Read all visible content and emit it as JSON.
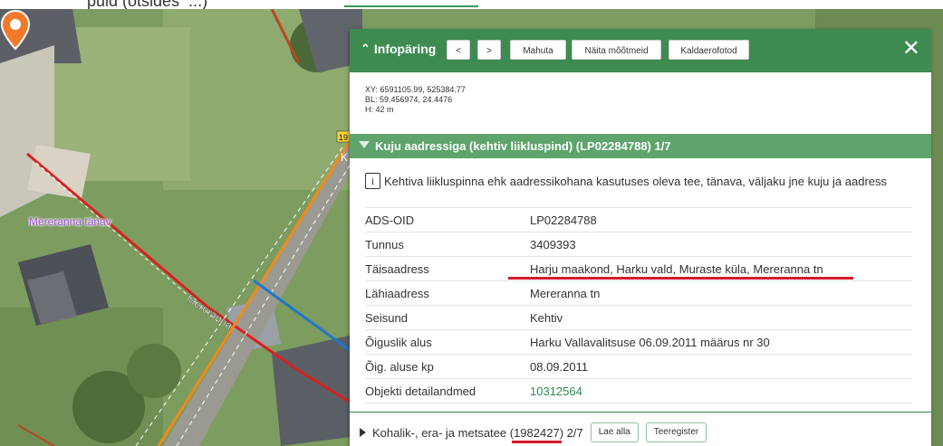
{
  "top_strip": {
    "partial_text": "puid (otsides  ...)"
  },
  "map": {
    "street_label": "Mereranna tänav",
    "road_label_rotated": "Mereranna",
    "road_number": "19",
    "road_letter": "K"
  },
  "panel": {
    "title": "Infopäring",
    "buttons": {
      "prev": "<",
      "next": ">",
      "fit": "Mahuta",
      "measurements": "Näita mõõtmeid",
      "oblique": "Kaldaerofotod"
    },
    "close": "✕",
    "coords": {
      "xy": "XY: 6591105.99, 525384.77",
      "bl": "BL: 59.456974, 24.4476",
      "h": "H: 42 m"
    },
    "section1": {
      "title": "Kuju aadressiga (kehtiv liikluspind) (LP02284788) 1/7",
      "description": "Kehtiva liikluspinna ehk aadressikohana kasutuses oleva tee, tänava, väljaku jne kuju ja aadress",
      "rows": [
        {
          "key": "ADS-OID",
          "value": "LP02284788"
        },
        {
          "key": "Tunnus",
          "value": "3409393"
        },
        {
          "key": "Täisaadress",
          "value": "Harju maakond, Harku vald, Muraste küla, Mereranna tn"
        },
        {
          "key": "Lähiaadress",
          "value": "Mereranna tn"
        },
        {
          "key": "Seisund",
          "value": "Kehtiv"
        },
        {
          "key": "Õiguslik alus",
          "value": "Harku Vallavalitsuse 06.09.2011 määrus nr 30"
        },
        {
          "key": "Õig. aluse kp",
          "value": "08.09.2011"
        },
        {
          "key": "Objekti detailandmed",
          "value": "10312564"
        }
      ]
    },
    "section2": {
      "title_prefix": "Kohalik-, era- ja metsatee (",
      "title_id": "1982427",
      "title_suffix": ") 2/7",
      "download": "Lae alla",
      "registry": "Teeregister"
    }
  },
  "colors": {
    "header_green": "#3d8b50",
    "section_green": "#5ea46c",
    "link_green": "#2d8a4d",
    "annotation_red": "#d11b2c",
    "marker_orange": "#f07a2a",
    "street_label_purple": "#a14fd8"
  }
}
